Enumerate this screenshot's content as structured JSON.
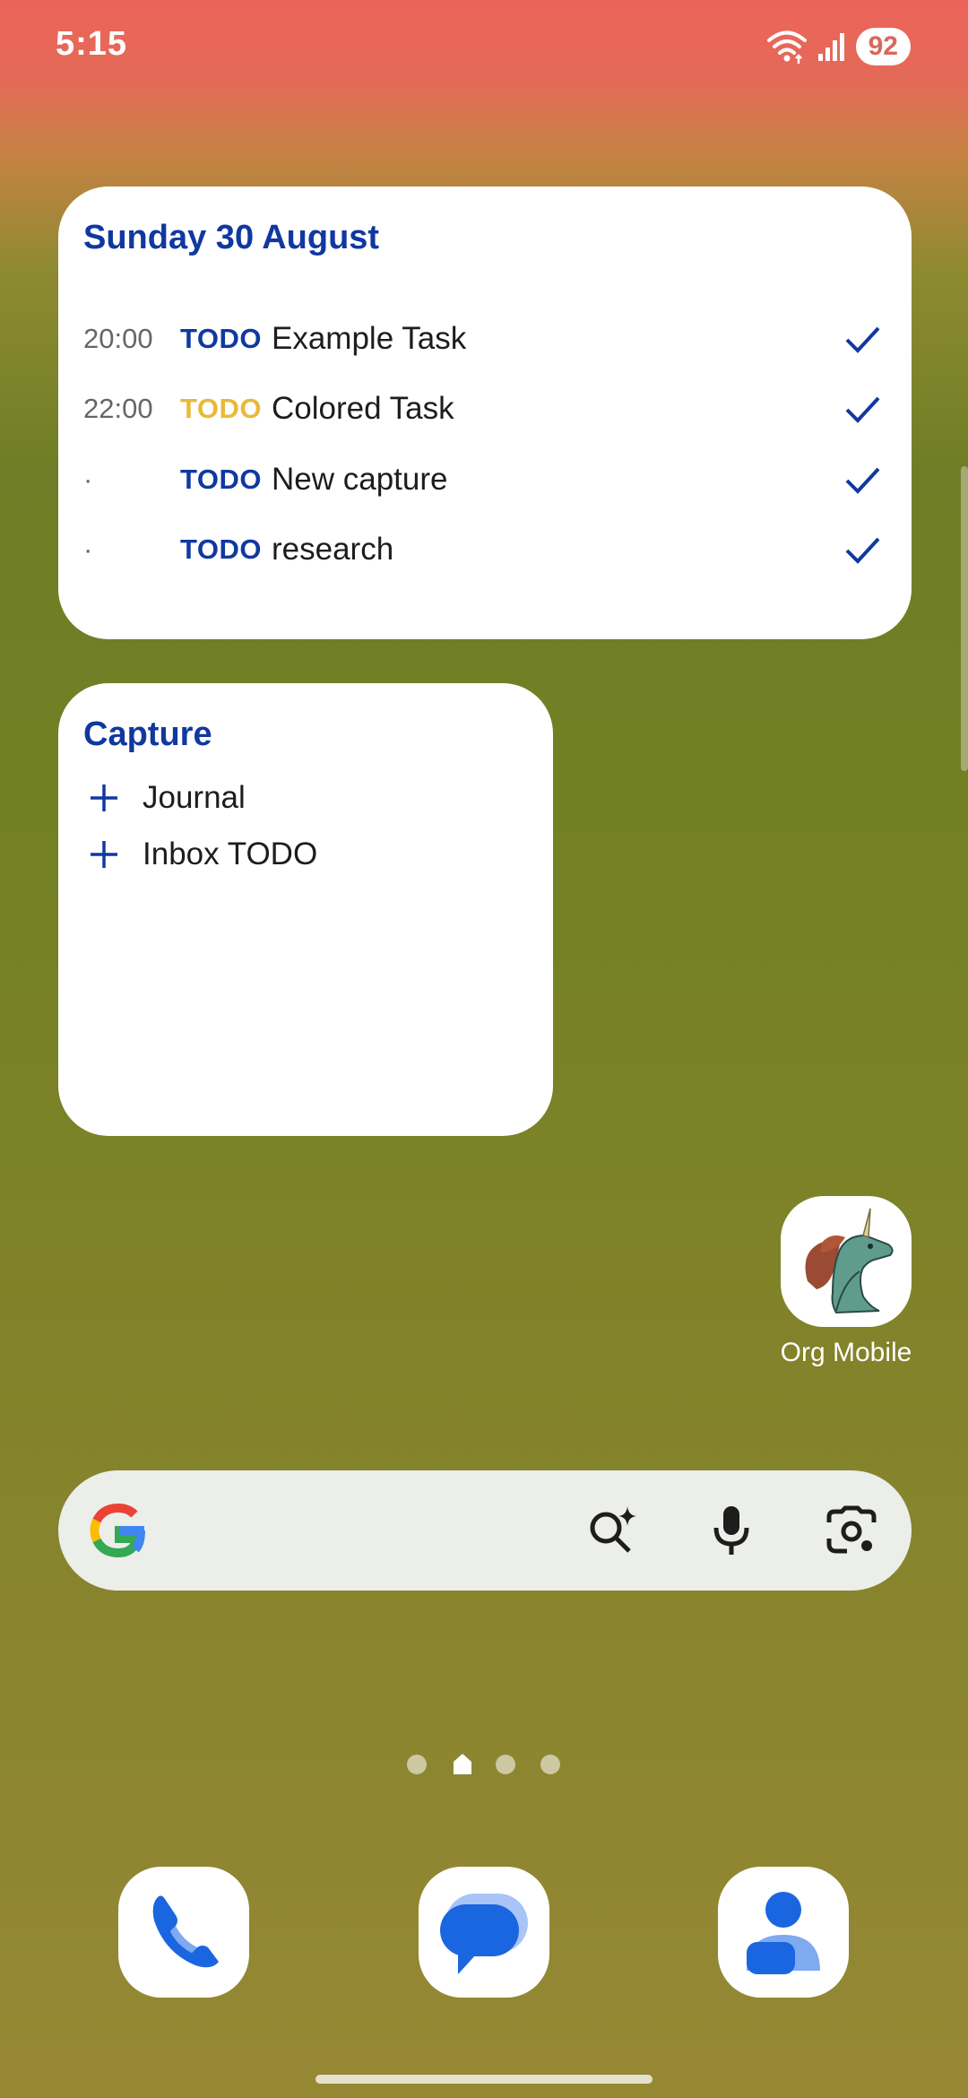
{
  "status_bar": {
    "time": "5:15",
    "battery": "92",
    "icons": [
      "wifi-icon",
      "signal-icon",
      "battery-icon"
    ]
  },
  "agenda_widget": {
    "title": "Sunday 30 August",
    "items": [
      {
        "time": "20:00",
        "keyword": "TODO",
        "keyword_color": "#1038a0",
        "text": "Example Task"
      },
      {
        "time": "22:00",
        "keyword": "TODO",
        "keyword_color": "#e8b93a",
        "text": "Colored Task"
      },
      {
        "time": "·",
        "keyword": "TODO",
        "keyword_color": "#1038a0",
        "text": "New capture"
      },
      {
        "time": "·",
        "keyword": "TODO",
        "keyword_color": "#1038a0",
        "text": "research"
      }
    ]
  },
  "capture_widget": {
    "title": "Capture",
    "items": [
      {
        "label": "Journal"
      },
      {
        "label": "Inbox TODO"
      }
    ]
  },
  "home_app": {
    "label": "Org Mobile",
    "icon": "unicorn-icon"
  },
  "search_bar": {
    "icons": [
      "google-logo-icon",
      "ai-search-icon",
      "microphone-icon",
      "lens-camera-icon"
    ]
  },
  "page_indicator": {
    "pages": 4,
    "current": 2
  },
  "dock": {
    "apps": [
      {
        "name": "Phone",
        "icon": "phone-icon"
      },
      {
        "name": "Messages",
        "icon": "messages-icon"
      },
      {
        "name": "Contacts",
        "icon": "contacts-icon"
      }
    ]
  },
  "colors": {
    "accent": "#1038a0",
    "warning_keyword": "#e8b93a"
  }
}
